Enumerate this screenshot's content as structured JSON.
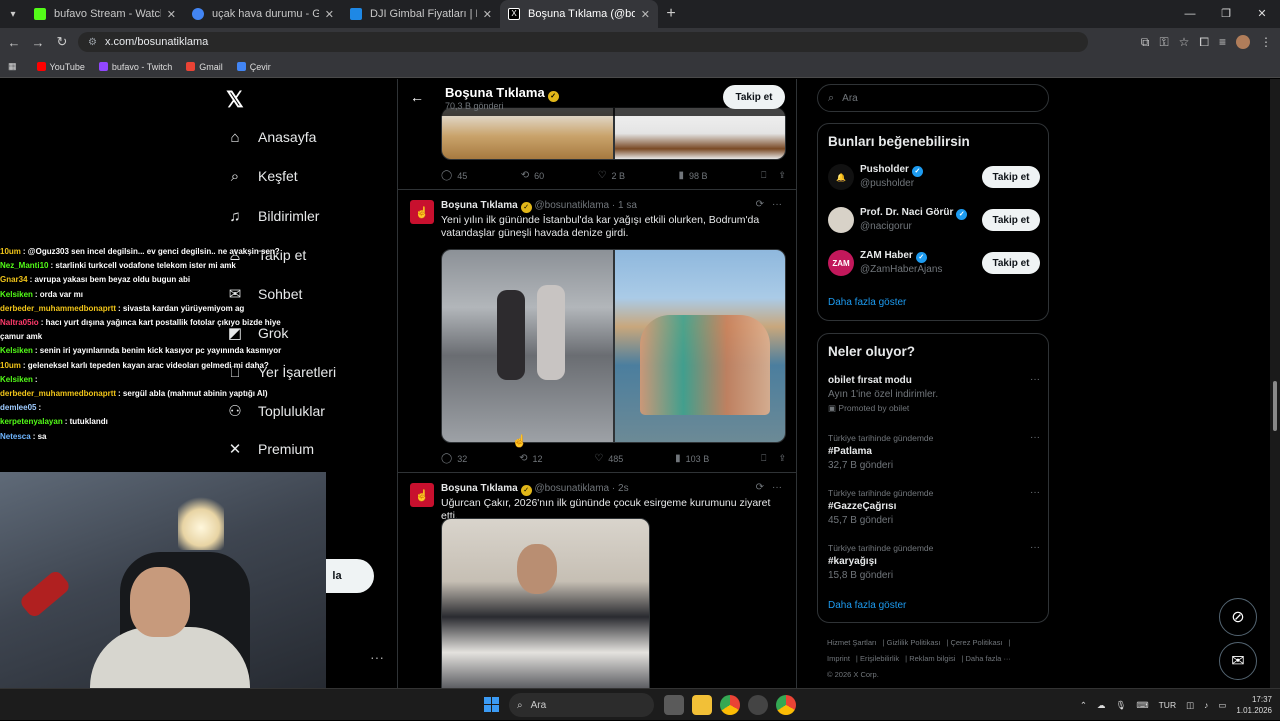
{
  "browser": {
    "tabs": [
      {
        "title": "bufavo Stream - Watch Live on",
        "color": "#53fc18"
      },
      {
        "title": "uçak hava durumu - Google'da",
        "color": "#4285f4"
      },
      {
        "title": "DJI Gimbal Fiyatları | En Ucuzu",
        "color": "#1e88e5"
      },
      {
        "title": "Boşuna Tıklama (@bosunatikla",
        "color": "#000000"
      }
    ],
    "url": "x.com/bosunatiklama",
    "bookmarks": [
      {
        "label": "YouTube",
        "color": "#ff0000"
      },
      {
        "label": "bufavo - Twitch",
        "color": "#9146ff"
      },
      {
        "label": "Gmail",
        "color": "#ea4335"
      },
      {
        "label": "Çevir",
        "color": "#4285f4"
      }
    ]
  },
  "left_nav": {
    "items": [
      {
        "label": "Anasayfa",
        "icon": "home-icon",
        "glyph": "⌂"
      },
      {
        "label": "Keşfet",
        "icon": "search-icon",
        "glyph": "⌕"
      },
      {
        "label": "Bildirimler",
        "icon": "bell-icon",
        "glyph": "🔔"
      },
      {
        "label": "Takip et",
        "icon": "person-plus-icon",
        "glyph": "♙"
      },
      {
        "label": "Sohbet",
        "icon": "mail-icon",
        "glyph": "✉"
      },
      {
        "label": "Grok",
        "icon": "grok-icon",
        "glyph": "◩"
      },
      {
        "label": "Yer İşaretleri",
        "icon": "bookmark-icon",
        "glyph": "⎕"
      },
      {
        "label": "Topluluklar",
        "icon": "communities-icon",
        "glyph": "⚇"
      },
      {
        "label": "Premium",
        "icon": "x-icon",
        "glyph": "𝕏"
      }
    ],
    "post_button": "la"
  },
  "chat": [
    {
      "user": "10um",
      "color": "#f0c419",
      "msg": ": @Oguz303 sen incel degilsin... ev genci degilsin.. ne avakşin sen?"
    },
    {
      "user": "Nez_Manti10",
      "color": "#53fc18",
      "msg": ": starlinki turkcell vodafone telekom ister mi amk"
    },
    {
      "user": "Gnar34",
      "color": "#f0c419",
      "msg": ": avrupa yakası bem beyaz oldu bugun abi"
    },
    {
      "user": "Kelsiken",
      "color": "#53fc18",
      "msg": ": orda var mı"
    },
    {
      "user": "derbeder_muhammedbonaprtt",
      "color": "#f0c419",
      "msg": ": sivasta kardan yürüyemiyom ag"
    },
    {
      "user": "Naltra05io",
      "color": "#ff3b6b",
      "msg": ": hacı yurt dışına yağınca kart postallik fotolar çıkıyo bizde hiye çamur amk"
    },
    {
      "user": "Kelsiken",
      "color": "#53fc18",
      "msg": ": senin iri yayınlarında benim kick kasıyor pc yayınında kasmıyor"
    },
    {
      "user": "10um",
      "color": "#f0c419",
      "msg": ": geleneksel karlı tepeden kayan arac videoları gelmedi mi daha?"
    },
    {
      "user": "Kelsiken",
      "color": "#53fc18",
      "msg": ":"
    },
    {
      "user": "derbeder_muhammedbonaprtt",
      "color": "#f0c419",
      "msg": ": sergül abla (mahmut abinin yaptığı AI)"
    },
    {
      "user": "demlee05",
      "color": "#9ecbff",
      "msg": ":"
    },
    {
      "user": "kerpetenyalayan",
      "color": "#53fc18",
      "msg": ": tutuklandı"
    },
    {
      "user": "Netesca",
      "color": "#6fb6ff",
      "msg": ": sa"
    }
  ],
  "profile": {
    "name": "Boşuna Tıklama",
    "posts_count": "70,3 B gönderi",
    "follow_label": "Takip et"
  },
  "tweets": [
    {
      "actions": {
        "replies": "45",
        "reposts": "60",
        "likes": "2 B",
        "views": "98 B"
      }
    },
    {
      "name": "Boşuna Tıklama",
      "handle": "@bosunatiklama",
      "time": "· 1 sa",
      "text": "Yeni yılın ilk gününde İstanbul'da kar yağışı etkili olurken, Bodrum'da vatandaşlar güneşli havada denize girdi.",
      "actions": {
        "replies": "32",
        "reposts": "12",
        "likes": "485",
        "views": "103 B"
      }
    },
    {
      "name": "Boşuna Tıklama",
      "handle": "@bosunatiklama",
      "time": "· 2s",
      "text": "Uğurcan Çakır, 2026'nın ilk gününde çocuk esirgeme kurumunu ziyaret etti."
    }
  ],
  "search": {
    "placeholder": "Ara"
  },
  "suggestions": {
    "title": "Bunları beğenebilirsin",
    "items": [
      {
        "name": "Pusholder",
        "handle": "@pusholder",
        "avatar_color": "#111111",
        "avatar_text": "🔔",
        "button": "Takip et"
      },
      {
        "name": "Prof. Dr. Naci Görür",
        "handle": "@nacigorur",
        "avatar_color": "#d8d2c8",
        "avatar_text": "",
        "button": "Takip et"
      },
      {
        "name": "ZAM Haber",
        "handle": "@ZamHaberAjans",
        "avatar_color": "#c2185b",
        "avatar_text": "ZAM",
        "button": "Takip et"
      }
    ],
    "more": "Daha fazla göster"
  },
  "trends": {
    "title": "Neler oluyor?",
    "items": [
      {
        "category": "",
        "title": "obilet fırsat modu",
        "sub": "Ayın 1'ine özel indirimler.",
        "extra": "Promoted by obilet"
      },
      {
        "category": "Türkiye tarihinde gündemde",
        "title": "#Patlama",
        "sub": "32,7 B gönderi"
      },
      {
        "category": "Türkiye tarihinde gündemde",
        "title": "#GazzeÇağrısı",
        "sub": "45,7 B gönderi"
      },
      {
        "category": "Türkiye tarihinde gündemde",
        "title": "#karyağışı",
        "sub": "15,8 B gönderi"
      }
    ],
    "more": "Daha fazla göster"
  },
  "footer": {
    "links": [
      "Hizmet Şartları",
      "Gizlilik Politikası",
      "Çerez Politikası",
      "Imprint",
      "Erişilebilirlik",
      "Reklam bilgisi",
      "Daha fazla ···"
    ],
    "copyright": "© 2026 X Corp."
  },
  "taskbar": {
    "search": "Ara",
    "lang": "TUR",
    "time": "17:37",
    "date": "1.01.2026"
  }
}
